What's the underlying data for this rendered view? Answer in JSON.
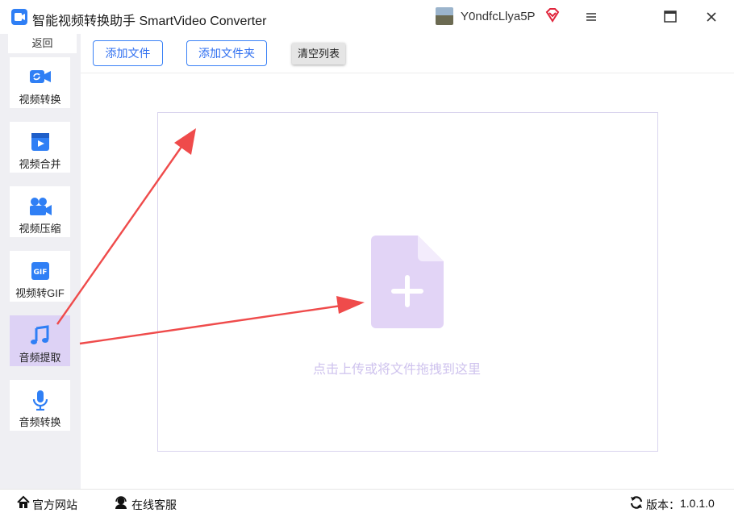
{
  "window": {
    "title": "智能视频转换助手 SmartVideo Converter",
    "username": "Y0ndfcLlya5P",
    "icons": [
      "app-logo-icon",
      "vip-diamond-icon",
      "menu-icon",
      "maximize-icon",
      "close-icon"
    ]
  },
  "sidebar": {
    "back_label": "返回",
    "items": [
      {
        "label": "视频转换",
        "icon": "video-convert-icon"
      },
      {
        "label": "视频合并",
        "icon": "video-merge-icon"
      },
      {
        "label": "视频压缩",
        "icon": "video-compress-icon"
      },
      {
        "label": "视频转GIF",
        "icon": "gif-icon"
      },
      {
        "label": "音频提取",
        "icon": "music-note-icon",
        "active": true
      },
      {
        "label": "音频转换",
        "icon": "microphone-icon"
      }
    ]
  },
  "toolbar": {
    "add_file": "添加文件",
    "add_folder": "添加文件夹",
    "clear_list": "清空列表"
  },
  "dropzone": {
    "hint": "点击上传或将文件拖拽到这里",
    "icon": "add-file-icon"
  },
  "statusbar": {
    "website": "官方网站",
    "support": "在线客服",
    "version_label": "版本：",
    "version": "1.0.1.0"
  },
  "colors": {
    "accent": "#2f7ff5",
    "active_nav": "#ddd2f5",
    "drop_icon": "#e2d4f6",
    "annotation_arrow": "#ef4b4b"
  }
}
